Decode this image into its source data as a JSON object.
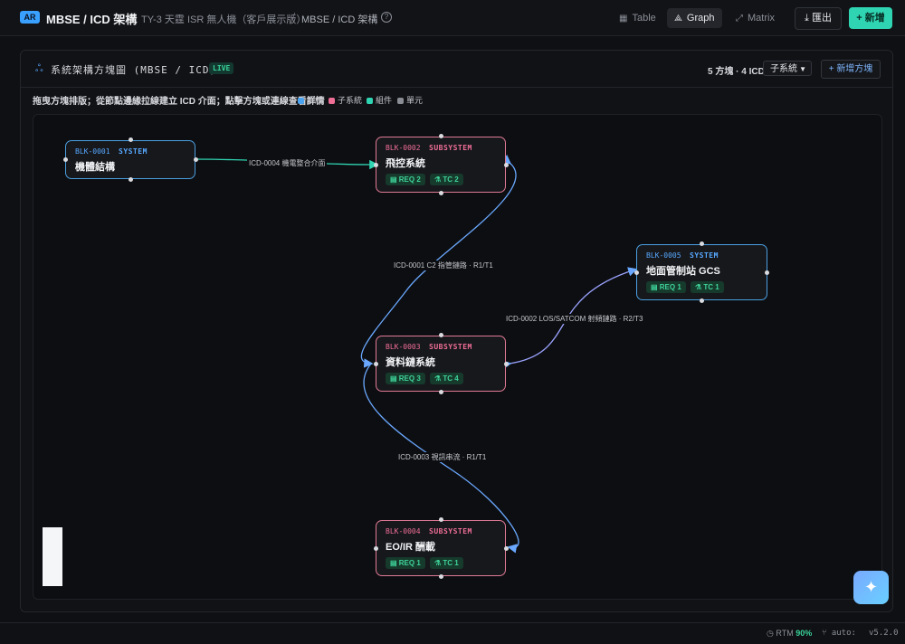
{
  "header": {
    "badge": "AR",
    "title": "MBSE / ICD 架構",
    "breadcrumb_project": "TY-3 天霆 ISR 無人機（客戶展示版）",
    "breadcrumb_sep": "/",
    "breadcrumb_current": "MBSE / ICD 架構",
    "help_icon": "?",
    "tabs": [
      {
        "label": "Table",
        "icon": "table-icon",
        "active": false
      },
      {
        "label": "Graph",
        "icon": "graph-icon",
        "active": true
      },
      {
        "label": "Matrix",
        "icon": "matrix-icon",
        "active": false
      }
    ],
    "export_label": "匯出",
    "add_label": "新增"
  },
  "panel": {
    "title": "系統架構方塊圖 (MBSE / ICD)",
    "live_badge": "LIVE",
    "counts": "5 方塊 · 4 ICD",
    "level_select": "子系統",
    "add_block_label": "新增方塊",
    "hint": "拖曳方塊排版；從節點邊緣拉線建立 ICD 介面；點擊方塊或連線查看詳情",
    "legend": [
      {
        "label": "系統",
        "color": "#4aa3f0"
      },
      {
        "label": "子系統",
        "color": "#ef6e96"
      },
      {
        "label": "組件",
        "color": "#2fd4b2"
      },
      {
        "label": "單元",
        "color": "#8a8d94"
      }
    ]
  },
  "blocks": [
    {
      "id": "BLK-0001",
      "type": "SYSTEM",
      "name": "機體結構",
      "req": "",
      "tc": ""
    },
    {
      "id": "BLK-0002",
      "type": "SUBSYSTEM",
      "name": "飛控系統",
      "req": "REQ 2",
      "tc": "TC 2"
    },
    {
      "id": "BLK-0003",
      "type": "SUBSYSTEM",
      "name": "資料鏈系統",
      "req": "REQ 3",
      "tc": "TC 4"
    },
    {
      "id": "BLK-0004",
      "type": "SUBSYSTEM",
      "name": "EO/IR 酬載",
      "req": "REQ 1",
      "tc": "TC 1"
    },
    {
      "id": "BLK-0005",
      "type": "SYSTEM",
      "name": "地面管制站 GCS",
      "req": "REQ 1",
      "tc": "TC 1"
    }
  ],
  "edges": [
    {
      "label": "ICD-0004 機電整合介面"
    },
    {
      "label": "ICD-0001 C2 指管鏈路 · R1/T1"
    },
    {
      "label": "ICD-0002 LOS/SATCOM 射頻鏈路 · R2/T3"
    },
    {
      "label": "ICD-0003 視訊串流 · R1/T1"
    }
  ],
  "status": {
    "rtm_label": "RTM",
    "rtm_value": "90%",
    "auto": "auto:",
    "version": "v5.2.0"
  },
  "colors": {
    "system": "#4a9fe0",
    "subsystem": "#e07a95",
    "edge_green": "#2fd4b2",
    "edge_blue": "#6aa8ff",
    "accent": "#2fd4b2"
  }
}
